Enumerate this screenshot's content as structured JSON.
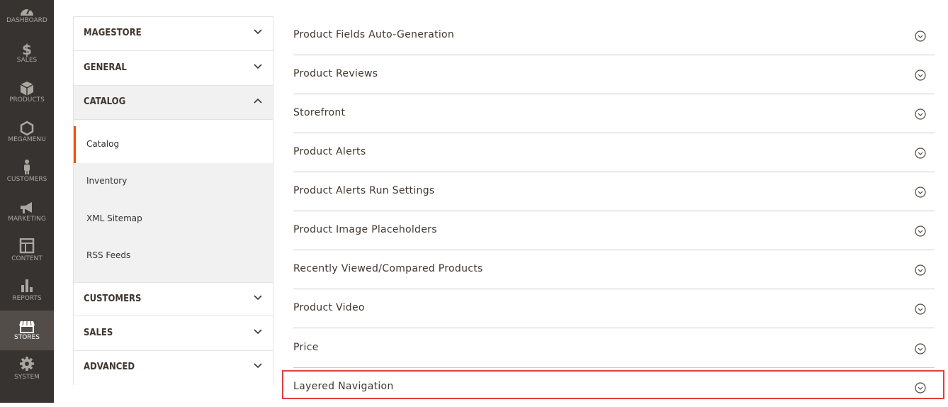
{
  "admin_menu": [
    {
      "label": "DASHBOARD",
      "icon": "dashboard-icon",
      "active": false
    },
    {
      "label": "SALES",
      "icon": "dollar-icon",
      "active": false
    },
    {
      "label": "PRODUCTS",
      "icon": "cube-icon",
      "active": false
    },
    {
      "label": "MEGAMENU",
      "icon": "hexagon-icon",
      "active": false
    },
    {
      "label": "CUSTOMERS",
      "icon": "person-icon",
      "active": false
    },
    {
      "label": "MARKETING",
      "icon": "megaphone-icon",
      "active": false
    },
    {
      "label": "CONTENT",
      "icon": "layout-icon",
      "active": false
    },
    {
      "label": "REPORTS",
      "icon": "bar-chart-icon",
      "active": false
    },
    {
      "label": "STORES",
      "icon": "storefront-icon",
      "active": true
    },
    {
      "label": "SYSTEM",
      "icon": "gear-icon",
      "active": false
    }
  ],
  "config_tabs": {
    "groups": [
      {
        "label": "MAGESTORE",
        "expanded": false
      },
      {
        "label": "GENERAL",
        "expanded": false
      },
      {
        "label": "CATALOG",
        "expanded": true
      },
      {
        "label": "CUSTOMERS",
        "expanded": false
      },
      {
        "label": "SALES",
        "expanded": false
      },
      {
        "label": "ADVANCED",
        "expanded": false
      }
    ],
    "catalog_items": [
      {
        "label": "Catalog",
        "active": true
      },
      {
        "label": "Inventory",
        "active": false
      },
      {
        "label": "XML Sitemap",
        "active": false
      },
      {
        "label": "RSS Feeds",
        "active": false
      }
    ]
  },
  "sections": [
    {
      "label": "Product Fields Auto-Generation"
    },
    {
      "label": "Product Reviews"
    },
    {
      "label": "Storefront"
    },
    {
      "label": "Product Alerts"
    },
    {
      "label": "Product Alerts Run Settings"
    },
    {
      "label": "Product Image Placeholders"
    },
    {
      "label": "Recently Viewed/Compared Products"
    },
    {
      "label": "Product Video"
    },
    {
      "label": "Price"
    },
    {
      "label": "Layered Navigation"
    }
  ],
  "colors": {
    "admin_bar": "#373330",
    "active_accent": "#eb5202",
    "highlight_border": "#e0403b"
  }
}
